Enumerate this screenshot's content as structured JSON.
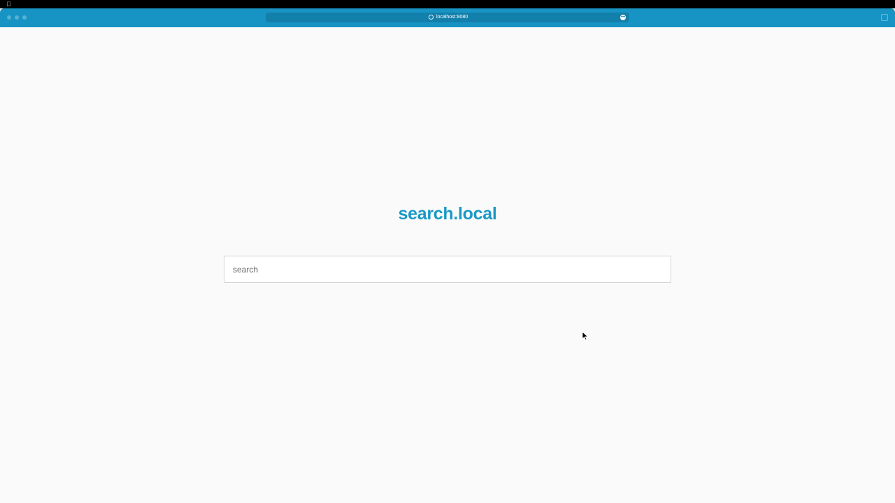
{
  "browser": {
    "url": "localhost:8080",
    "more_icon": "ellipsis-icon",
    "toolbar_color": "#1794c4"
  },
  "page": {
    "title": "search.local",
    "search_placeholder": "search",
    "search_value": "",
    "accent_color": "#1a99c7"
  }
}
